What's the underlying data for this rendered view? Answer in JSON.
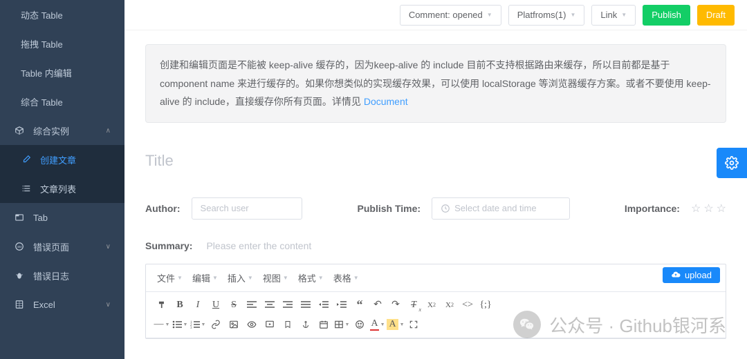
{
  "sidebar": {
    "items": [
      {
        "label": "动态 Table",
        "icon": ""
      },
      {
        "label": "拖拽 Table",
        "icon": ""
      },
      {
        "label": "Table 内编辑",
        "icon": ""
      },
      {
        "label": "综合 Table",
        "icon": ""
      }
    ],
    "group_examples": {
      "label": "综合实例",
      "icon": "component-icon",
      "expanded": true
    },
    "examples": [
      {
        "label": "创建文章",
        "icon": "edit-icon",
        "active": true
      },
      {
        "label": "文章列表",
        "icon": "list-icon",
        "active": false
      }
    ],
    "tab": {
      "label": "Tab",
      "icon": "tab-icon"
    },
    "error_page": {
      "label": "错误页面",
      "icon": "404-icon"
    },
    "error_log": {
      "label": "错误日志",
      "icon": "bug-icon"
    },
    "excel": {
      "label": "Excel",
      "icon": "excel-icon"
    }
  },
  "topbar": {
    "comment": {
      "label": "Comment: opened"
    },
    "platforms": {
      "label": "Platfroms(1)"
    },
    "link": {
      "label": "Link"
    },
    "publish": "Publish",
    "draft": "Draft"
  },
  "notice": {
    "text": "创建和编辑页面是不能被 keep-alive 缓存的，因为keep-alive 的 include 目前不支持根据路由来缓存，所以目前都是基于 component name 来进行缓存的。如果你想类似的实现缓存效果，可以使用 localStorage 等浏览器缓存方案。或者不要使用 keep-alive 的 include，直接缓存你所有页面。详情见 ",
    "link_text": "Document"
  },
  "form": {
    "title_placeholder": "Title",
    "author_label": "Author:",
    "author_placeholder": "Search user",
    "publish_time_label": "Publish Time:",
    "publish_time_placeholder": "Select date and time",
    "importance_label": "Importance:",
    "summary_label": "Summary:",
    "summary_placeholder": "Please enter the content"
  },
  "editor": {
    "menu": [
      "文件",
      "编辑",
      "插入",
      "视图",
      "格式",
      "表格"
    ],
    "upload": "upload"
  },
  "watermark": "公众号 · Github银河系"
}
